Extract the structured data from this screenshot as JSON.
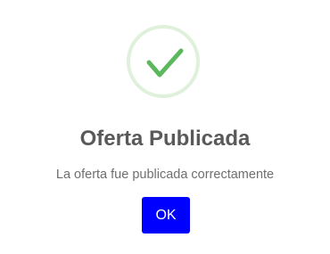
{
  "dialog": {
    "icon": "checkmark-icon",
    "title": "Oferta Publicada",
    "message": "La oferta fue publicada correctamente",
    "ok_label": "OK"
  },
  "colors": {
    "success_green": "#5cb85c",
    "success_ring": "#dff0db",
    "button_blue": "#0000ff",
    "title_text": "#595959",
    "message_text": "#6f6f6f"
  }
}
